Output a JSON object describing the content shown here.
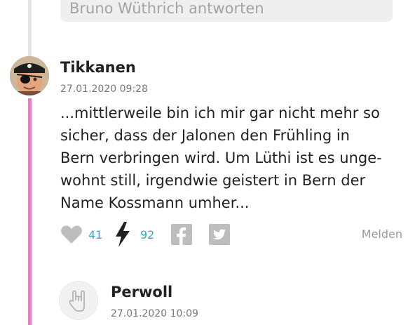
{
  "reply": {
    "placeholder_text": "Bruno Wüthrich antworten"
  },
  "comment": {
    "author": "Tikkanen",
    "date": "27.01.2020 09:28",
    "lines": [
      "...mittlerweile bin ich mir gar nicht mehr so",
      "sicher, dass der Jalonen den Frühling in",
      "Bern verbringen wird. Um Lüthi ist es unge-",
      "wohnt still, irgendwie geistert in Bern der",
      "Name Kossmann umher..."
    ],
    "likes": "41",
    "flashes": "92",
    "report_label": "Melden"
  },
  "next_comment": {
    "author": "Perwoll",
    "date": "27.01.2020 10:09"
  },
  "colors": {
    "thread_line": "#e37fbf",
    "count": "#3ba5cc",
    "icon_gray": "#bdbdbd"
  },
  "icons": {
    "like": "heart-icon",
    "flash": "lightning-icon",
    "facebook": "facebook-icon",
    "twitter": "twitter-icon",
    "avatar_placeholder": "rock-hand-icon"
  }
}
